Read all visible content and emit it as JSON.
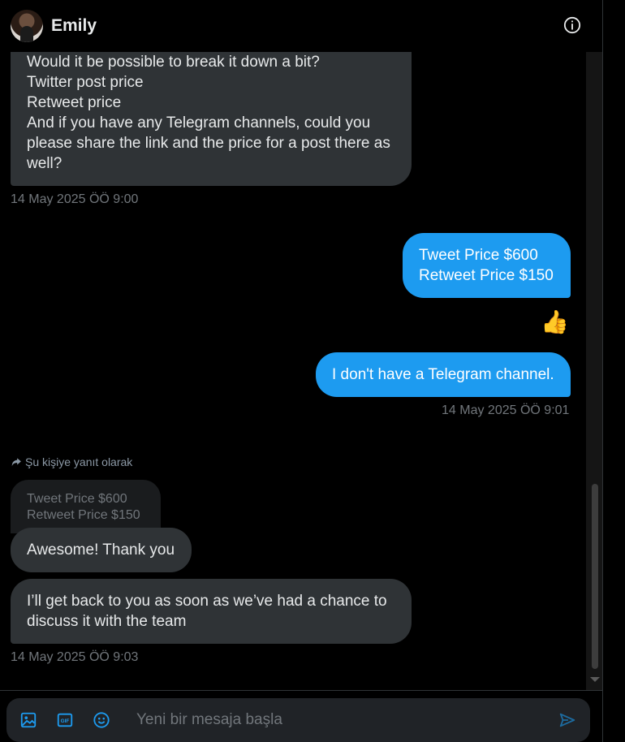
{
  "header": {
    "contact_name": "Emily"
  },
  "messages": {
    "m1_lines": [
      "Would it be possible to break it down a bit?",
      "Twitter post price",
      "Retweet price",
      "And if you have any Telegram channels, could you",
      "please share the link and the price for a post there as",
      "well?"
    ],
    "m1_time": "14 May 2025 ÖÖ 9:00",
    "m2_lines": [
      "Tweet Price $600",
      "Retweet Price $150"
    ],
    "m3_emoji": "👍",
    "m4_text": "I don't have a Telegram channel.",
    "m4_time": "14 May 2025 ÖÖ 9:01",
    "reply_label": "Şu kişiye yanıt olarak",
    "quoted_lines": [
      "Tweet Price $600",
      "Retweet Price $150"
    ],
    "m5_text": "Awesome! Thank you",
    "m6_lines": [
      "I’ll get back to you as soon as we’ve had a chance to",
      "discuss it with the team"
    ],
    "m6_time": "14 May 2025 ÖÖ 9:03"
  },
  "composer": {
    "placeholder": "Yeni bir mesaja başla"
  },
  "colors": {
    "accent": "#1d9bf0",
    "bubble_in": "#2f3336",
    "muted": "#71767b"
  }
}
